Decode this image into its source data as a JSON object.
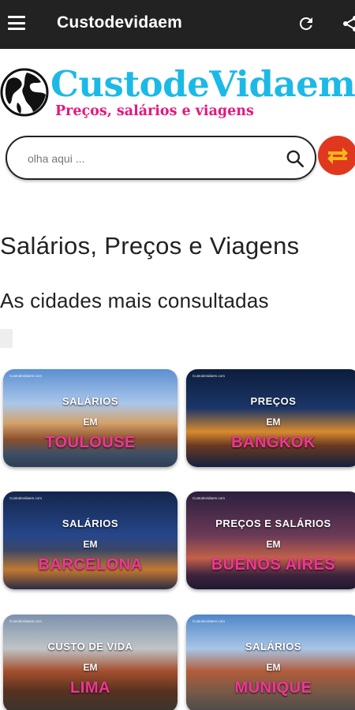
{
  "appbar": {
    "title": "Custodevidaem",
    "menu_icon": "hamburger-menu-icon",
    "refresh_icon": "refresh-icon",
    "share_icon": "share-icon"
  },
  "logo": {
    "title": "CustodeVidaem",
    "subtitle": "Preços, salários e viagens",
    "globe_icon": "globe-icon"
  },
  "search": {
    "placeholder": "olha aqui ...",
    "value": "",
    "icon": "search-icon",
    "swap_icon": "swap-arrows-icon"
  },
  "headings": {
    "main": "Salários, Preços e Viagens",
    "sub": "As cidades mais consultadas"
  },
  "colors": {
    "appbar": "#222222",
    "logo_blue": "#1cb9e6",
    "logo_pink": "#e4187d",
    "swap_button": "#e0381e",
    "city_pink": "#f13598"
  },
  "cards": [
    {
      "watermark": "Custodevidaem.com",
      "line1": "SALÁRIOS",
      "line2": "EM",
      "city": "TOULOUSE"
    },
    {
      "watermark": "Custodevidaem.com",
      "line1": "PREÇOS",
      "line2": "EM",
      "city": "BANGKOK"
    },
    {
      "watermark": "Custodevidaem.com",
      "line1": "SALÁRIOS",
      "line2": "EM",
      "city": "BARCELONA"
    },
    {
      "watermark": "Custodevidaem.com",
      "line1": "PREÇOS E SALÁRIOS",
      "line2": "EM",
      "city": "BUENOS AIRES"
    },
    {
      "watermark": "Custodevidaem.com",
      "line1": "CUSTO DE VIDA",
      "line2": "EM",
      "city": "LIMA"
    },
    {
      "watermark": "Custodevidaem.com",
      "line1": "SALÁRIOS",
      "line2": "EM",
      "city": "MUNIQUE"
    }
  ]
}
